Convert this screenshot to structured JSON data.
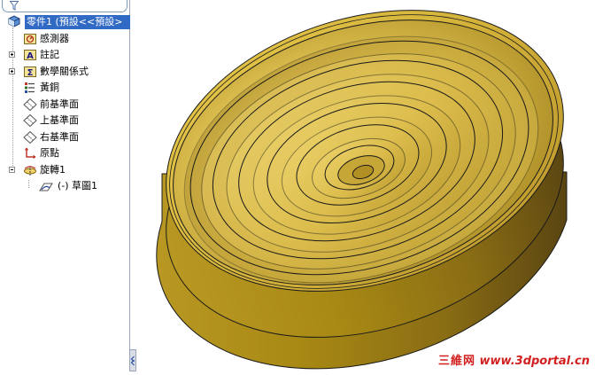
{
  "feature_tree": {
    "root_label": "零件1 (預設<<預設>",
    "items": [
      {
        "label": "感測器",
        "icon": "sensor-icon",
        "expandable": false
      },
      {
        "label": "註記",
        "icon": "annotation-icon",
        "expandable": true
      },
      {
        "label": "數學關係式",
        "icon": "equation-icon",
        "expandable": true
      },
      {
        "label": "黃銅",
        "icon": "material-icon",
        "expandable": false
      },
      {
        "label": "前基準面",
        "icon": "plane-icon",
        "expandable": false
      },
      {
        "label": "上基準面",
        "icon": "plane-icon",
        "expandable": false
      },
      {
        "label": "右基準面",
        "icon": "plane-icon",
        "expandable": false
      },
      {
        "label": "原點",
        "icon": "origin-icon",
        "expandable": false
      },
      {
        "label": "旋轉1",
        "icon": "revolve-icon",
        "expandable": true,
        "expanded": true
      }
    ],
    "sub_item": {
      "label": "(-) 草圖1",
      "icon": "sketch-icon"
    }
  },
  "watermark": {
    "chinese": "三維网",
    "url": "www.3dportal.cn"
  },
  "colors": {
    "selection": "#316ac5",
    "brass_light": "#f0d25e",
    "brass_mid": "#c9a22c",
    "brass_dark": "#6b5413"
  }
}
